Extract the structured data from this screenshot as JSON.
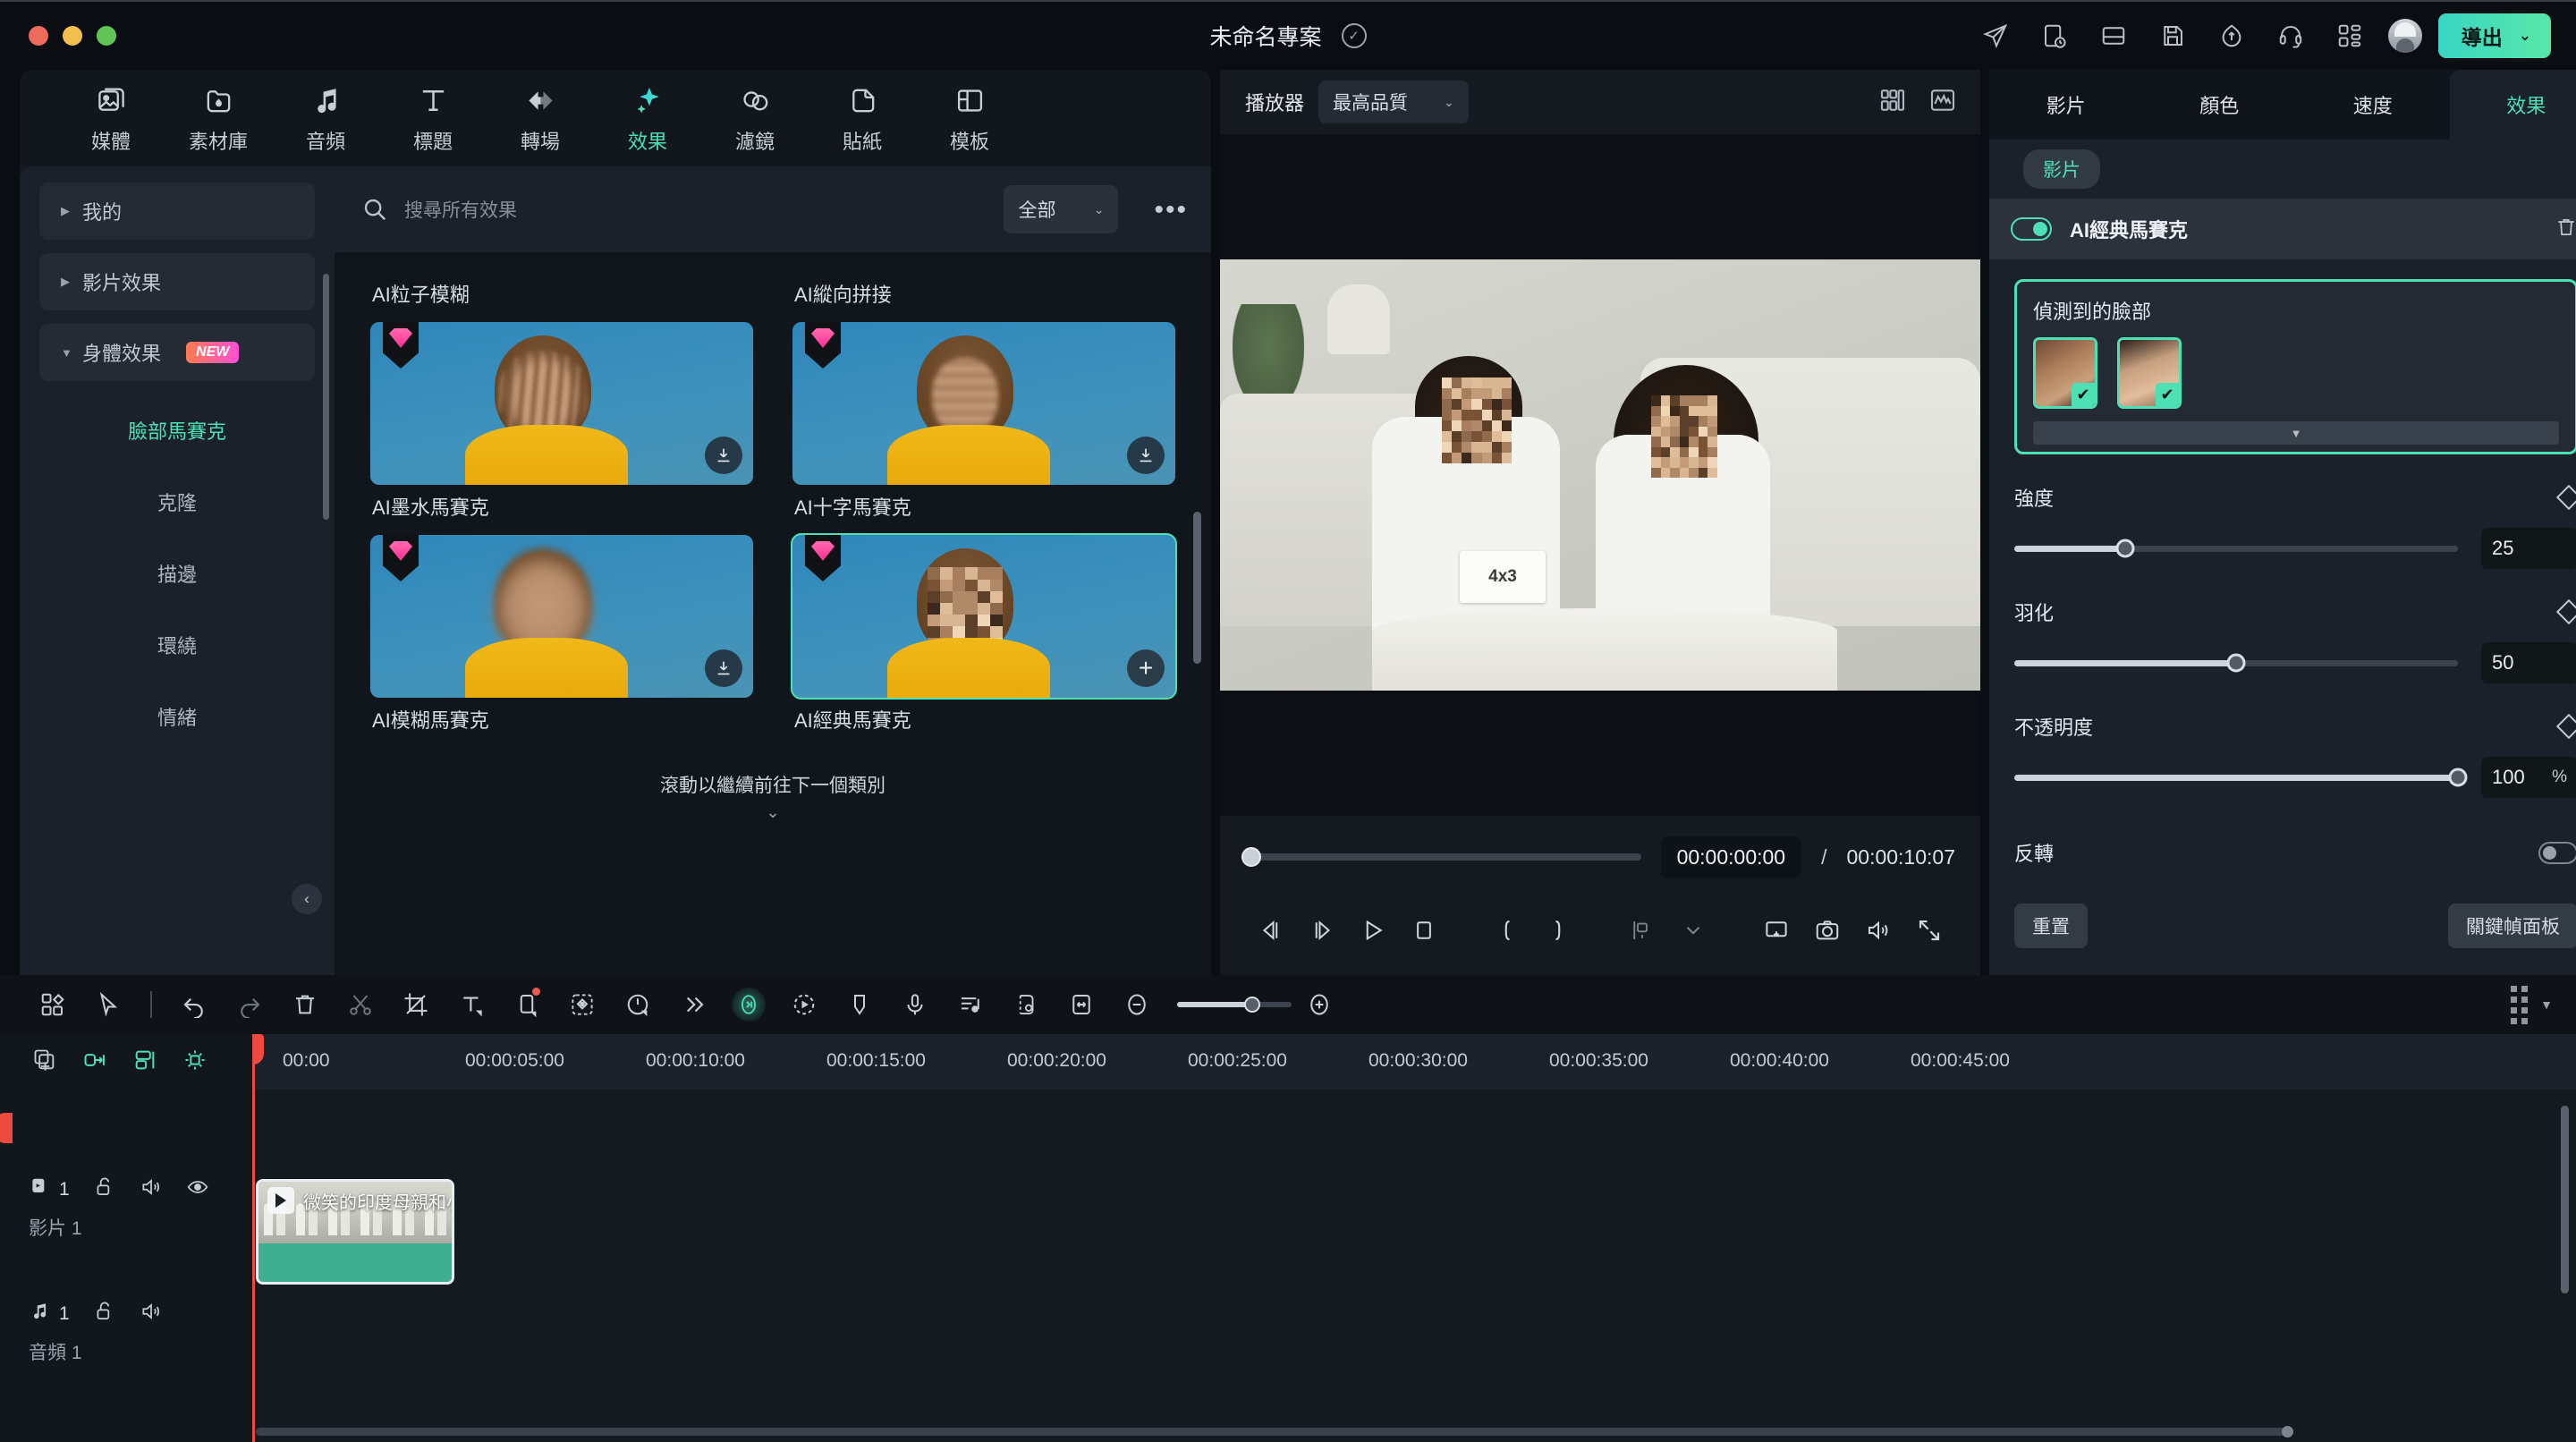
{
  "titlebar": {
    "project_name": "未命名專案",
    "saved_icon": "check-circle-icon",
    "icons": [
      "send-icon",
      "task-list-icon",
      "layout-icon",
      "save-icon",
      "cloud-upload-icon",
      "headset-support-icon",
      "apps-grid-icon"
    ],
    "export_label": "導出",
    "export_chevron": "⌄",
    "accent": "#4ee0b5"
  },
  "nav_tabs": [
    {
      "label": "媒體",
      "icon": "media-icon",
      "active": false
    },
    {
      "label": "素材庫",
      "icon": "stock-library-icon",
      "active": false
    },
    {
      "label": "音頻",
      "icon": "audio-icon",
      "active": false
    },
    {
      "label": "標題",
      "icon": "title-text-icon",
      "active": false
    },
    {
      "label": "轉場",
      "icon": "transition-icon",
      "active": false
    },
    {
      "label": "效果",
      "icon": "effects-sparkle-icon",
      "active": true
    },
    {
      "label": "濾鏡",
      "icon": "filter-icon",
      "active": false
    },
    {
      "label": "貼紙",
      "icon": "sticker-icon",
      "active": false
    },
    {
      "label": "模板",
      "icon": "template-icon",
      "active": false
    }
  ],
  "category_sidebar": {
    "groups": [
      {
        "label": "我的",
        "expanded": false,
        "badge": null
      },
      {
        "label": "影片效果",
        "expanded": false,
        "badge": null
      },
      {
        "label": "身體效果",
        "expanded": true,
        "badge": "NEW"
      }
    ],
    "items": [
      {
        "label": "臉部馬賽克",
        "selected": true
      },
      {
        "label": "克隆",
        "selected": false
      },
      {
        "label": "描邊",
        "selected": false
      },
      {
        "label": "環繞",
        "selected": false
      },
      {
        "label": "情緒",
        "selected": false
      }
    ],
    "collapse_icon": "chevron-left-icon"
  },
  "search": {
    "placeholder": "搜尋所有效果",
    "icon": "search-icon",
    "filter_label": "全部",
    "more_label": "•••"
  },
  "effects_grid": {
    "items": [
      {
        "title": "AI粒子模糊",
        "pro": true,
        "state": "download",
        "style": "particle"
      },
      {
        "title": "AI縱向拼接",
        "pro": true,
        "state": "download",
        "style": "vertical"
      },
      {
        "title": "AI墨水馬賽克",
        "pro": true,
        "state": "download",
        "style": "blur"
      },
      {
        "title": "AI十字馬賽克",
        "pro": true,
        "state": "add",
        "style": "mosaic",
        "selected": true
      },
      {
        "title": "AI模糊馬賽克",
        "pro": false,
        "state": "none",
        "style": "soft"
      },
      {
        "title": "AI經典馬賽克",
        "pro": false,
        "state": "none",
        "style": "classic"
      }
    ],
    "scroll_hint": "滾動以繼續前往下一個類別",
    "scroll_chevrons": "⌄"
  },
  "player": {
    "label": "播放器",
    "quality": "最高品質",
    "quality_chevron": "⌄",
    "right_icons": [
      "grid-view-icon",
      "waveform-scope-icon"
    ],
    "current_time": "00:00:00:00",
    "separator": "/",
    "total_time": "00:00:10:07",
    "video_card_text": "4x3",
    "controls": [
      "prev-frame-icon",
      "next-frame-icon",
      "play-icon",
      "stop-icon",
      "mark-in-icon",
      "mark-out-icon",
      "snapshot-marker-icon",
      "chevron-down-icon",
      "pop-out-icon",
      "camera-icon",
      "volume-icon",
      "fullscreen-icon"
    ]
  },
  "right_panel": {
    "tabs": [
      {
        "label": "影片",
        "active": false
      },
      {
        "label": "顏色",
        "active": false
      },
      {
        "label": "速度",
        "active": false
      },
      {
        "label": "效果",
        "active": true
      }
    ],
    "chip": "影片",
    "effect_row": {
      "name": "AI經典馬賽克",
      "enabled": true,
      "delete_icon": "trash-icon"
    },
    "faces": {
      "title": "偵測到的臉部",
      "thumbs": [
        {
          "checked": true,
          "label": "face-1"
        },
        {
          "checked": true,
          "label": "face-2"
        }
      ],
      "expand_icon": "chevron-down-icon"
    },
    "params": [
      {
        "label": "強度",
        "value": "25",
        "unit": "",
        "pct": 25,
        "keyframe_icon": "diamond-keyframe-icon"
      },
      {
        "label": "羽化",
        "value": "50",
        "unit": "",
        "pct": 50,
        "keyframe_icon": "diamond-keyframe-icon"
      },
      {
        "label": "不透明度",
        "value": "100",
        "unit": "%",
        "pct": 100,
        "keyframe_icon": "diamond-keyframe-icon"
      }
    ],
    "invert": {
      "label": "反轉",
      "enabled": false
    },
    "reset_label": "重置",
    "keyframe_panel_label": "關鍵幀面板"
  },
  "timeline": {
    "toolbar_icons": [
      "add-media-icon",
      "select-tool-icon",
      "undo-icon",
      "redo-icon",
      "delete-icon",
      "split-icon",
      "crop-icon",
      "text-icon",
      "mask-icon",
      "color-match-icon",
      "speed-icon",
      "more-icon",
      "ai-smart-icon",
      "motion-tracking-icon",
      "marker-icon",
      "voiceover-icon",
      "audio-mix-icon",
      "render-preview-icon",
      "fit-timeline-icon",
      "zoom-out-icon",
      "zoom-in-icon",
      "track-manager-icon"
    ],
    "left_icons": [
      "add-track-icon",
      "link-icon",
      "align-icon",
      "keyframe-icon"
    ],
    "ruler_ticks": [
      "00:00",
      "00:00:05:00",
      "00:00:10:00",
      "00:00:15:00",
      "00:00:20:00",
      "00:00:25:00",
      "00:00:30:00",
      "00:00:35:00",
      "00:00:40:00",
      "00:00:45:00"
    ],
    "tracks": [
      {
        "type": "video",
        "num": "1",
        "name": "影片 1",
        "icons": [
          "video-track-icon",
          "unlock-icon",
          "mute-icon",
          "eye-icon"
        ]
      },
      {
        "type": "audio",
        "num": "1",
        "name": "音頻 1",
        "icons": [
          "audio-track-icon",
          "unlock-icon",
          "mute-icon"
        ]
      }
    ],
    "clip": {
      "title": "微笑的印度母親和小初中女生...",
      "play_icon": "play-icon"
    }
  }
}
